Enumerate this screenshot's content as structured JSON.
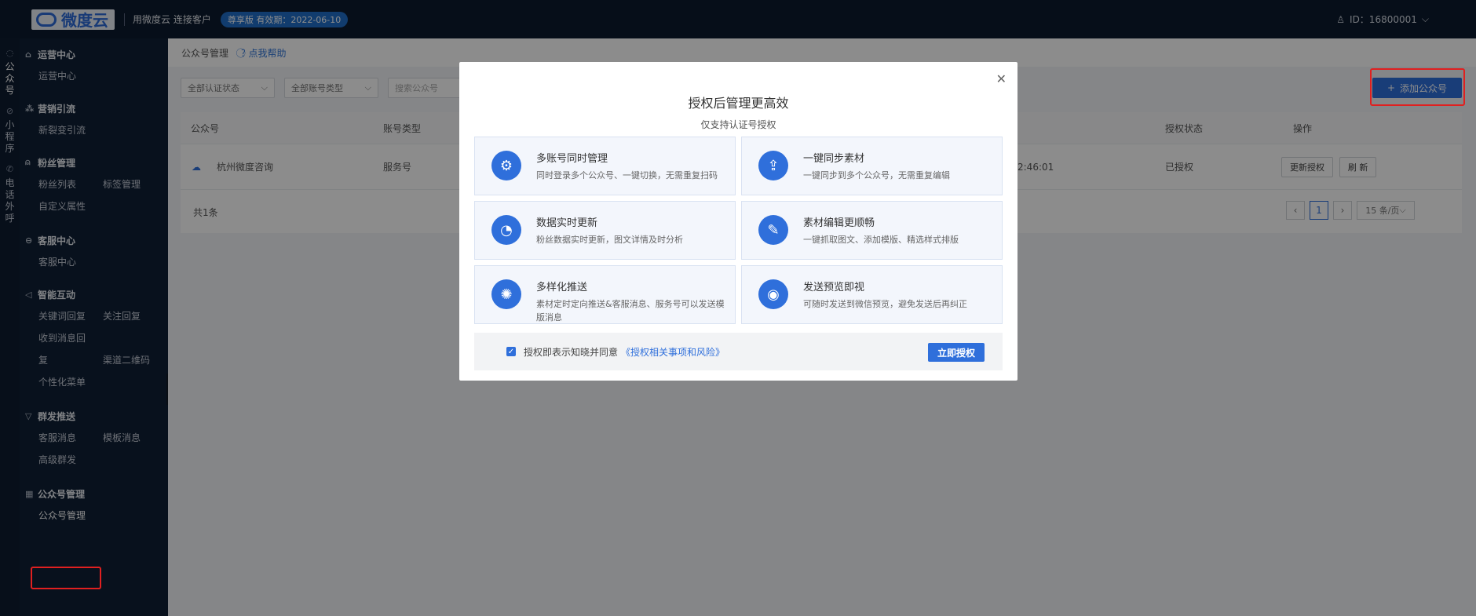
{
  "topbar": {
    "logo_text": "微度云",
    "slogan": "用微度云 连接客户",
    "badge": "尊享版 有效期：2022-06-10",
    "user_id": "ID：16800001"
  },
  "rail": [
    {
      "label": "公众号",
      "icon": "wechat-icon"
    },
    {
      "label": "小程序",
      "icon": "miniapp-icon"
    },
    {
      "label": "电话外呼",
      "icon": "phone-icon"
    }
  ],
  "sidebar": {
    "sections": [
      {
        "title": "运营中心",
        "icon": "home-icon",
        "items": [
          "运营中心"
        ]
      },
      {
        "title": "营销引流",
        "icon": "share-icon",
        "items": [
          "新裂变引流"
        ]
      },
      {
        "title": "粉丝管理",
        "icon": "user-group-icon",
        "items": [
          "粉丝列表",
          "标签管理",
          "自定义属性"
        ]
      },
      {
        "title": "客服中心",
        "icon": "chat-icon",
        "items": [
          "客服中心"
        ]
      },
      {
        "title": "智能互动",
        "icon": "speaker-icon",
        "items": [
          "关键词回复",
          "关注回复",
          "收到消息回",
          "渠道二维码",
          "复",
          "个性化菜单"
        ]
      },
      {
        "title": "群发推送",
        "icon": "filter-icon",
        "items": [
          "客服消息",
          "模板消息",
          "高级群发"
        ]
      },
      {
        "title": "公众号管理",
        "icon": "grid-icon",
        "items": [
          "公众号管理"
        ]
      }
    ]
  },
  "main": {
    "crumb": "公众号管理",
    "help": "点我帮助",
    "filters": [
      "全部认证状态",
      "全部账号类型"
    ],
    "search_placeholder": "搜索公众号",
    "add_button": "添加公众号",
    "columns": [
      "公众号",
      "账号类型",
      "授权状态",
      "操作"
    ],
    "row": {
      "name": "杭州微度咨询",
      "type": "服务号",
      "time_fragment": "2:46:01",
      "status": "已授权",
      "actions": [
        "更新授权",
        "刷 新"
      ]
    },
    "total": "共1条",
    "page": "1",
    "page_size": "15 条/页"
  },
  "modal": {
    "title": "授权后管理更高效",
    "subtitle": "仅支持认证号授权",
    "cards": [
      {
        "title": "多账号同时管理",
        "desc": "同时登录多个公众号、一键切换，无需重复扫码",
        "icon": "gear-icon"
      },
      {
        "title": "一键同步素材",
        "desc": "一键同步到多个公众号，无需重复编辑",
        "icon": "upload-icon"
      },
      {
        "title": "数据实时更新",
        "desc": "粉丝数据实时更新，图文详情及时分析",
        "icon": "pie-chart-icon"
      },
      {
        "title": "素材编辑更顺畅",
        "desc": "一键抓取图文、添加模版、精选样式排版",
        "icon": "pen-icon"
      },
      {
        "title": "多样化推送",
        "desc": "素材定时定向推送&客服消息、服务号可以发送模版消息",
        "icon": "broadcast-icon"
      },
      {
        "title": "发送预览即视",
        "desc": "可随时发送到微信预览，避免发送后再纠正",
        "icon": "eye-icon"
      }
    ],
    "agree_text": "授权即表示知晓并同意",
    "agree_link": "《授权相关事项和风险》",
    "auth_button": "立即授权"
  }
}
